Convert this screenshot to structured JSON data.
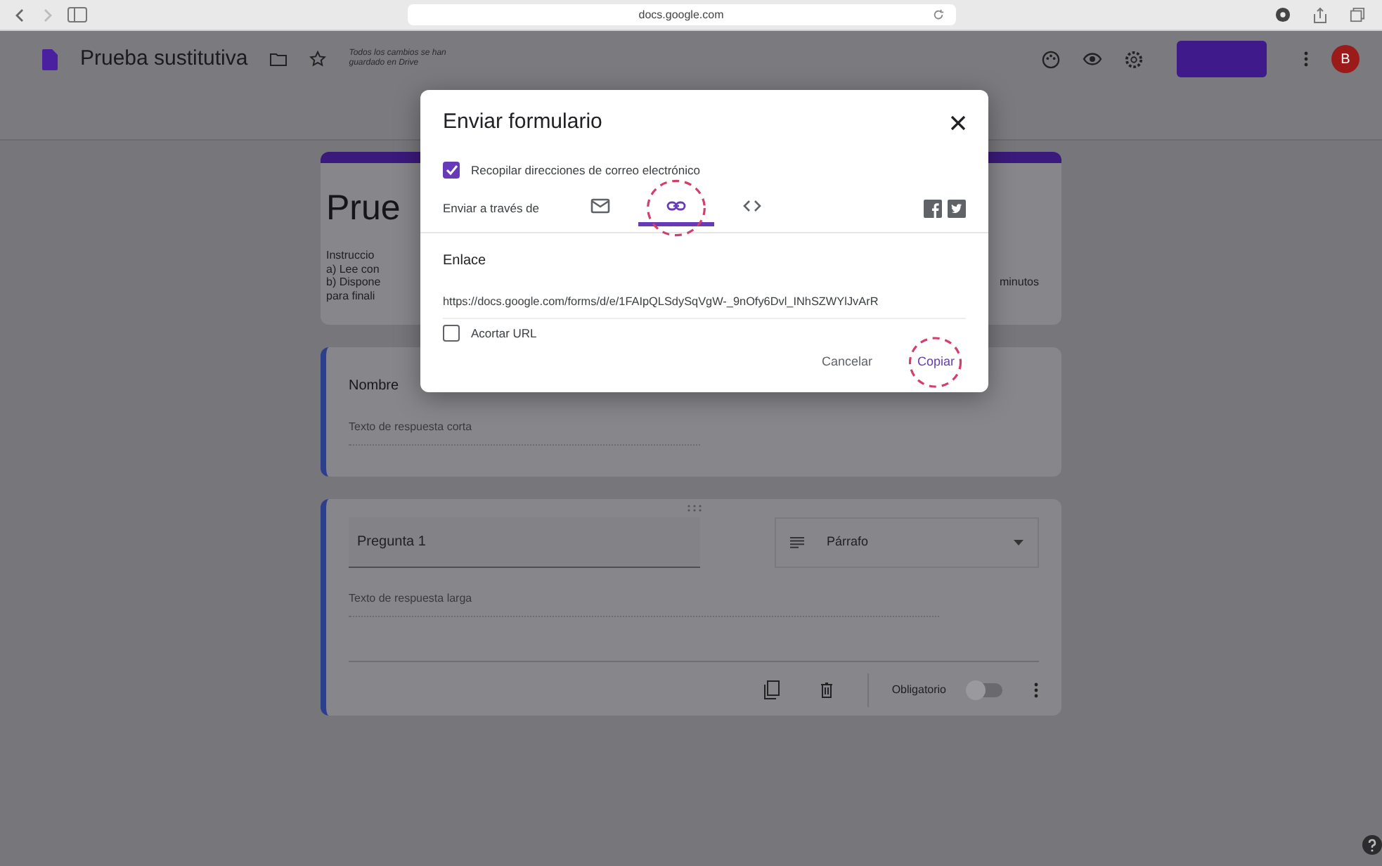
{
  "browser": {
    "address": "docs.google.com"
  },
  "header": {
    "title": "Prueba sustitutiva",
    "save_status": [
      "Todos los cambios se han",
      "guardado en Drive"
    ],
    "avatar": "B"
  },
  "form": {
    "title": "Prue",
    "description_lines": [
      "Instruccio",
      "a) Lee con",
      "b) Dispone",
      "para finali"
    ],
    "description_tail": "minutos"
  },
  "questions": [
    {
      "kind": "short",
      "title": "Nombre",
      "answer_hint": "Texto de respuesta corta",
      "focused": true
    },
    {
      "kind": "paragraph",
      "title": "Pregunta 1",
      "type": "Párrafo",
      "answer_hint": "Texto de respuesta larga",
      "required_label": "Obligatorio",
      "required": false,
      "focused": true
    }
  ],
  "dialog": {
    "title": "Enviar formulario",
    "collect_emails": {
      "label": "Recopilar direcciones de correo electrónico",
      "checked": true
    },
    "send_via_label": "Enviar a través de",
    "send_methods": [
      {
        "kind": "email",
        "selected": false,
        "highlighted": false
      },
      {
        "kind": "link",
        "selected": true,
        "highlighted": true
      },
      {
        "kind": "embed",
        "selected": false,
        "highlighted": false
      }
    ],
    "share": [
      {
        "kind": "facebook"
      },
      {
        "kind": "twitter"
      }
    ],
    "link_label": "Enlace",
    "url": "https://docs.google.com/forms/d/e/1FAIpQLSdySqVgW-_9nOfy6Dvl_INhSZWYlJvArR",
    "shorten": {
      "label": "Acortar URL",
      "checked": false
    },
    "buttons": [
      {
        "label": "Cancelar",
        "kind": "secondary",
        "highlighted": false
      },
      {
        "label": "Copiar",
        "kind": "primary",
        "highlighted": true
      }
    ]
  }
}
